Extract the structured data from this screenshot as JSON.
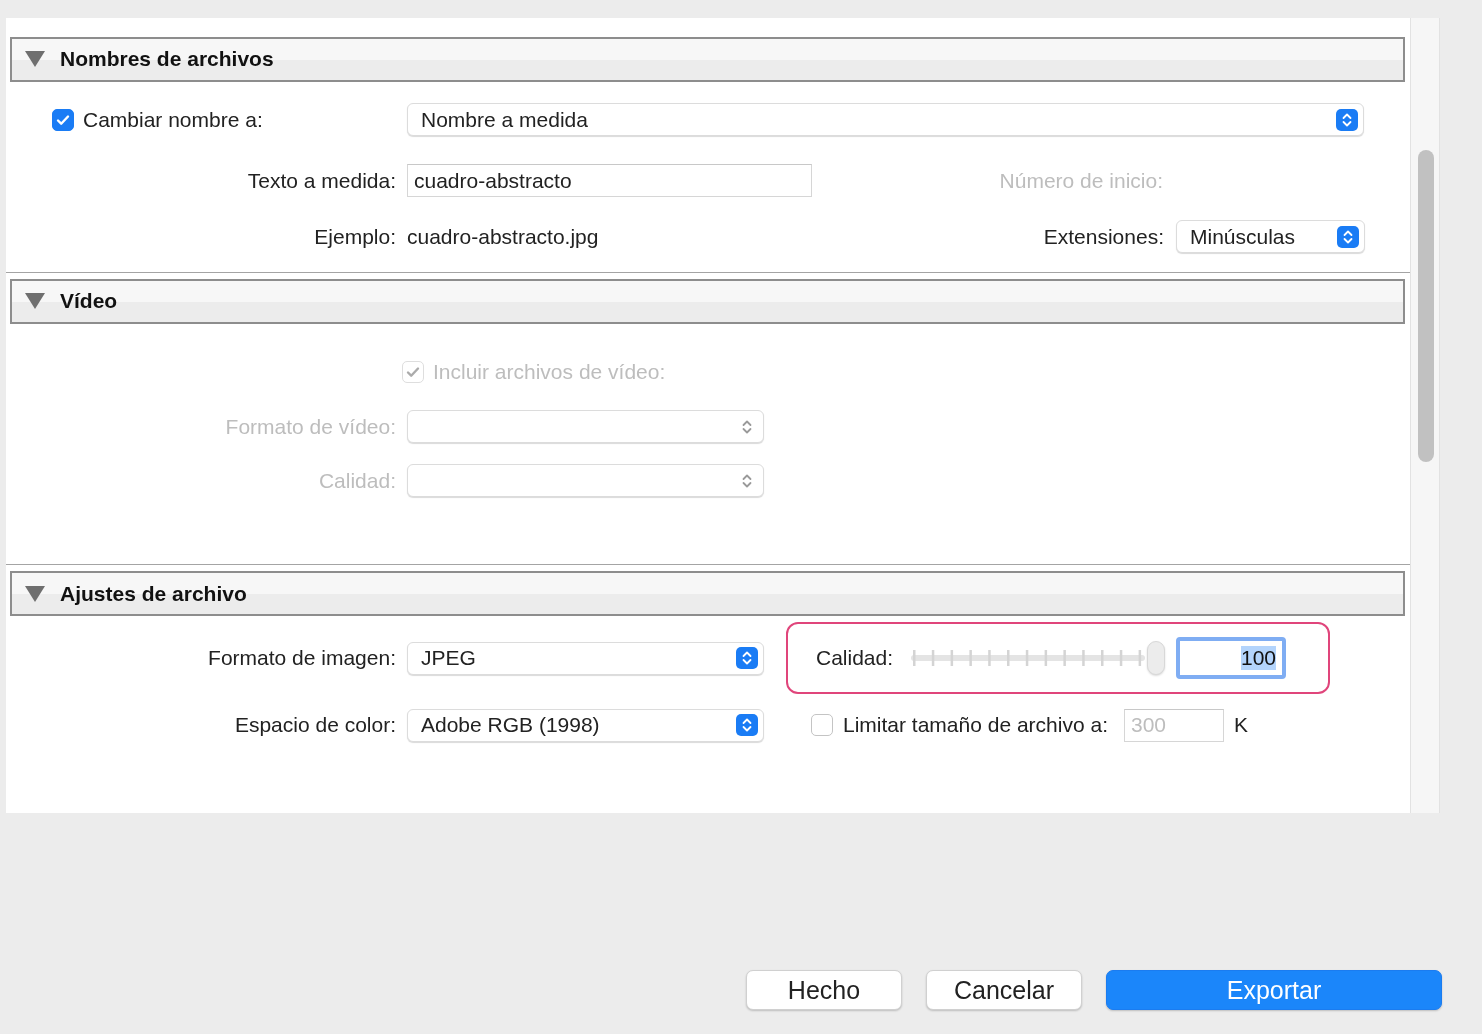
{
  "sections": [
    {
      "kind": "naming",
      "title": "Nombres de archivos",
      "expanded": true,
      "rename": {
        "label": "Cambiar nombre a:",
        "checked": true,
        "value": "Nombre a medida"
      },
      "custom_text": {
        "label": "Texto a medida:",
        "value": "cuadro-abstracto"
      },
      "start_number": {
        "label": "Número de inicio:",
        "disabled": true
      },
      "example": {
        "label": "Ejemplo:",
        "value": "cuadro-abstracto.jpg"
      },
      "extensions": {
        "label": "Extensiones:",
        "value": "Minúsculas"
      }
    },
    {
      "kind": "video",
      "title": "Vídeo",
      "expanded": true,
      "include": {
        "label": "Incluir archivos de vídeo:",
        "checked": true,
        "disabled": true
      },
      "format": {
        "label": "Formato de vídeo:",
        "disabled": true
      },
      "quality": {
        "label": "Calidad:",
        "disabled": true
      }
    },
    {
      "kind": "file",
      "title": "Ajustes de archivo",
      "expanded": true,
      "image_format": {
        "label": "Formato de imagen:",
        "value": "JPEG"
      },
      "quality": {
        "label": "Calidad:",
        "level": 1,
        "value": "100",
        "highlighted": true
      },
      "color_space": {
        "label": "Espacio de color:",
        "value": "Adobe RGB (1998)"
      },
      "limit": {
        "label": "Limitar tamaño de archivo a:",
        "checked": false,
        "value": "300",
        "unit": "K"
      }
    }
  ],
  "buttons": [
    {
      "label": "Hecho",
      "kind": "default"
    },
    {
      "label": "Cancelar",
      "kind": "default"
    },
    {
      "label": "Exportar",
      "kind": "primary"
    }
  ]
}
